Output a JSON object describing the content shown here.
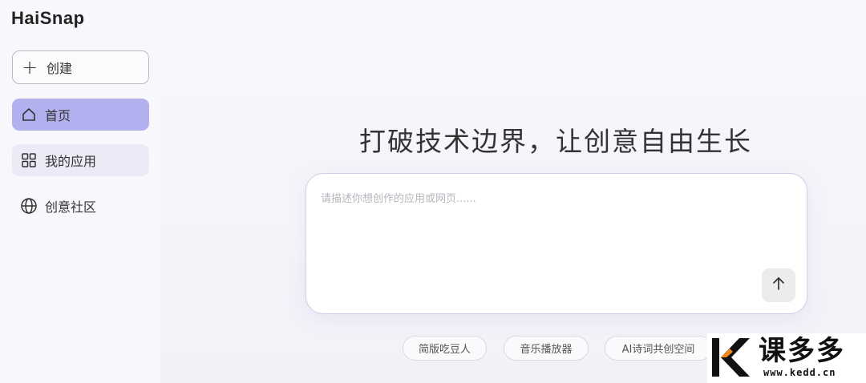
{
  "app": {
    "logo_text": "HaiSnap"
  },
  "sidebar": {
    "create_label": "创建",
    "items": [
      {
        "label": "首页",
        "icon": "home-icon",
        "active": true
      },
      {
        "label": "我的应用",
        "icon": "apps-grid-icon",
        "active": false
      },
      {
        "label": "创意社区",
        "icon": "globe-icon",
        "active": false
      }
    ]
  },
  "main": {
    "headline": "打破技术边界，让创意自由生长",
    "prompt": {
      "placeholder": "请描述你想创作的应用或网页......",
      "value": ""
    },
    "send_icon": "arrow-up-icon",
    "suggestions": [
      "简版吃豆人",
      "音乐播放器",
      "AI诗词共创空间"
    ]
  },
  "watermark": {
    "brand": "课多多",
    "url": "www.kedd.cn"
  },
  "colors": {
    "active_nav": "#b2b0ee",
    "apps_nav": "#ebeaf6",
    "watermark_accent": "#f08a1c"
  }
}
